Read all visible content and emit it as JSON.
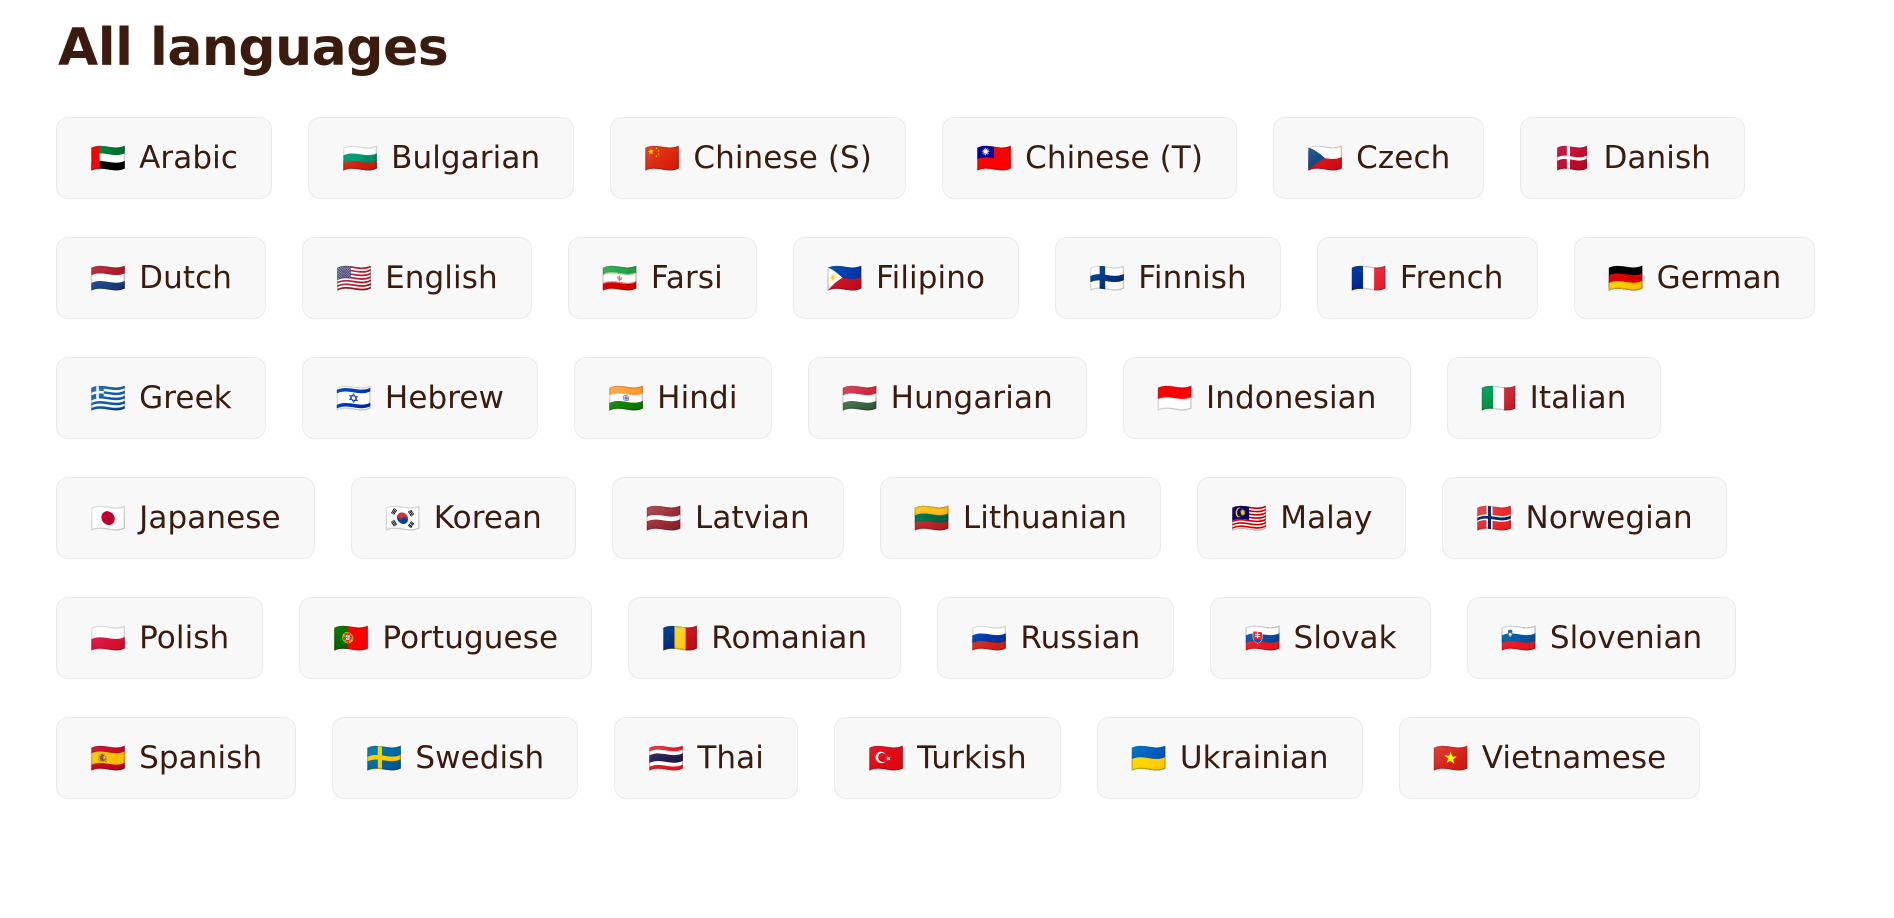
{
  "page": {
    "title": "All languages",
    "title_color": "#3a1b0d",
    "background_color": "#ffffff",
    "chip_background_color": "#f8f8f8",
    "chip_border_color": "#ebebeb"
  },
  "language_rows": [
    [
      {
        "flag": "🇦🇪",
        "label": "Arabic",
        "icon_name": "flag-united-arab-emirates-icon"
      },
      {
        "flag": "🇧🇬",
        "label": "Bulgarian",
        "icon_name": "flag-bulgaria-icon"
      },
      {
        "flag": "🇨🇳",
        "label": "Chinese (S)",
        "icon_name": "flag-china-icon"
      },
      {
        "flag": "🇹🇼",
        "label": "Chinese (T)",
        "icon_name": "flag-taiwan-icon"
      },
      {
        "flag": "🇨🇿",
        "label": "Czech",
        "icon_name": "flag-czechia-icon"
      },
      {
        "flag": "🇩🇰",
        "label": "Danish",
        "icon_name": "flag-denmark-icon"
      }
    ],
    [
      {
        "flag": "🇳🇱",
        "label": "Dutch",
        "icon_name": "flag-netherlands-icon"
      },
      {
        "flag": "🇺🇸",
        "label": "English",
        "icon_name": "flag-united-states-icon"
      },
      {
        "flag": "🇮🇷",
        "label": "Farsi",
        "icon_name": "flag-iran-icon"
      },
      {
        "flag": "🇵🇭",
        "label": "Filipino",
        "icon_name": "flag-philippines-icon"
      },
      {
        "flag": "🇫🇮",
        "label": "Finnish",
        "icon_name": "flag-finland-icon"
      },
      {
        "flag": "🇫🇷",
        "label": "French",
        "icon_name": "flag-france-icon"
      },
      {
        "flag": "🇩🇪",
        "label": "German",
        "icon_name": "flag-germany-icon"
      }
    ],
    [
      {
        "flag": "🇬🇷",
        "label": "Greek",
        "icon_name": "flag-greece-icon"
      },
      {
        "flag": "🇮🇱",
        "label": "Hebrew",
        "icon_name": "flag-israel-icon"
      },
      {
        "flag": "🇮🇳",
        "label": "Hindi",
        "icon_name": "flag-india-icon"
      },
      {
        "flag": "🇭🇺",
        "label": "Hungarian",
        "icon_name": "flag-hungary-icon"
      },
      {
        "flag": "🇮🇩",
        "label": "Indonesian",
        "icon_name": "flag-indonesia-icon"
      },
      {
        "flag": "🇮🇹",
        "label": "Italian",
        "icon_name": "flag-italy-icon"
      }
    ],
    [
      {
        "flag": "🇯🇵",
        "label": "Japanese",
        "icon_name": "flag-japan-icon"
      },
      {
        "flag": "🇰🇷",
        "label": "Korean",
        "icon_name": "flag-south-korea-icon"
      },
      {
        "flag": "🇱🇻",
        "label": "Latvian",
        "icon_name": "flag-latvia-icon"
      },
      {
        "flag": "🇱🇹",
        "label": "Lithuanian",
        "icon_name": "flag-lithuania-icon"
      },
      {
        "flag": "🇲🇾",
        "label": "Malay",
        "icon_name": "flag-malaysia-icon"
      },
      {
        "flag": "🇳🇴",
        "label": "Norwegian",
        "icon_name": "flag-norway-icon"
      }
    ],
    [
      {
        "flag": "🇵🇱",
        "label": "Polish",
        "icon_name": "flag-poland-icon"
      },
      {
        "flag": "🇵🇹",
        "label": "Portuguese",
        "icon_name": "flag-portugal-icon"
      },
      {
        "flag": "🇷🇴",
        "label": "Romanian",
        "icon_name": "flag-romania-icon"
      },
      {
        "flag": "🇷🇺",
        "label": "Russian",
        "icon_name": "flag-russia-icon"
      },
      {
        "flag": "🇸🇰",
        "label": "Slovak",
        "icon_name": "flag-slovakia-icon"
      },
      {
        "flag": "🇸🇮",
        "label": "Slovenian",
        "icon_name": "flag-slovenia-icon"
      }
    ],
    [
      {
        "flag": "🇪🇸",
        "label": "Spanish",
        "icon_name": "flag-spain-icon"
      },
      {
        "flag": "🇸🇪",
        "label": "Swedish",
        "icon_name": "flag-sweden-icon"
      },
      {
        "flag": "🇹🇭",
        "label": "Thai",
        "icon_name": "flag-thailand-icon"
      },
      {
        "flag": "🇹🇷",
        "label": "Turkish",
        "icon_name": "flag-turkey-icon"
      },
      {
        "flag": "🇺🇦",
        "label": "Ukrainian",
        "icon_name": "flag-ukraine-icon"
      },
      {
        "flag": "🇻🇳",
        "label": "Vietnamese",
        "icon_name": "flag-vietnam-icon"
      }
    ]
  ]
}
